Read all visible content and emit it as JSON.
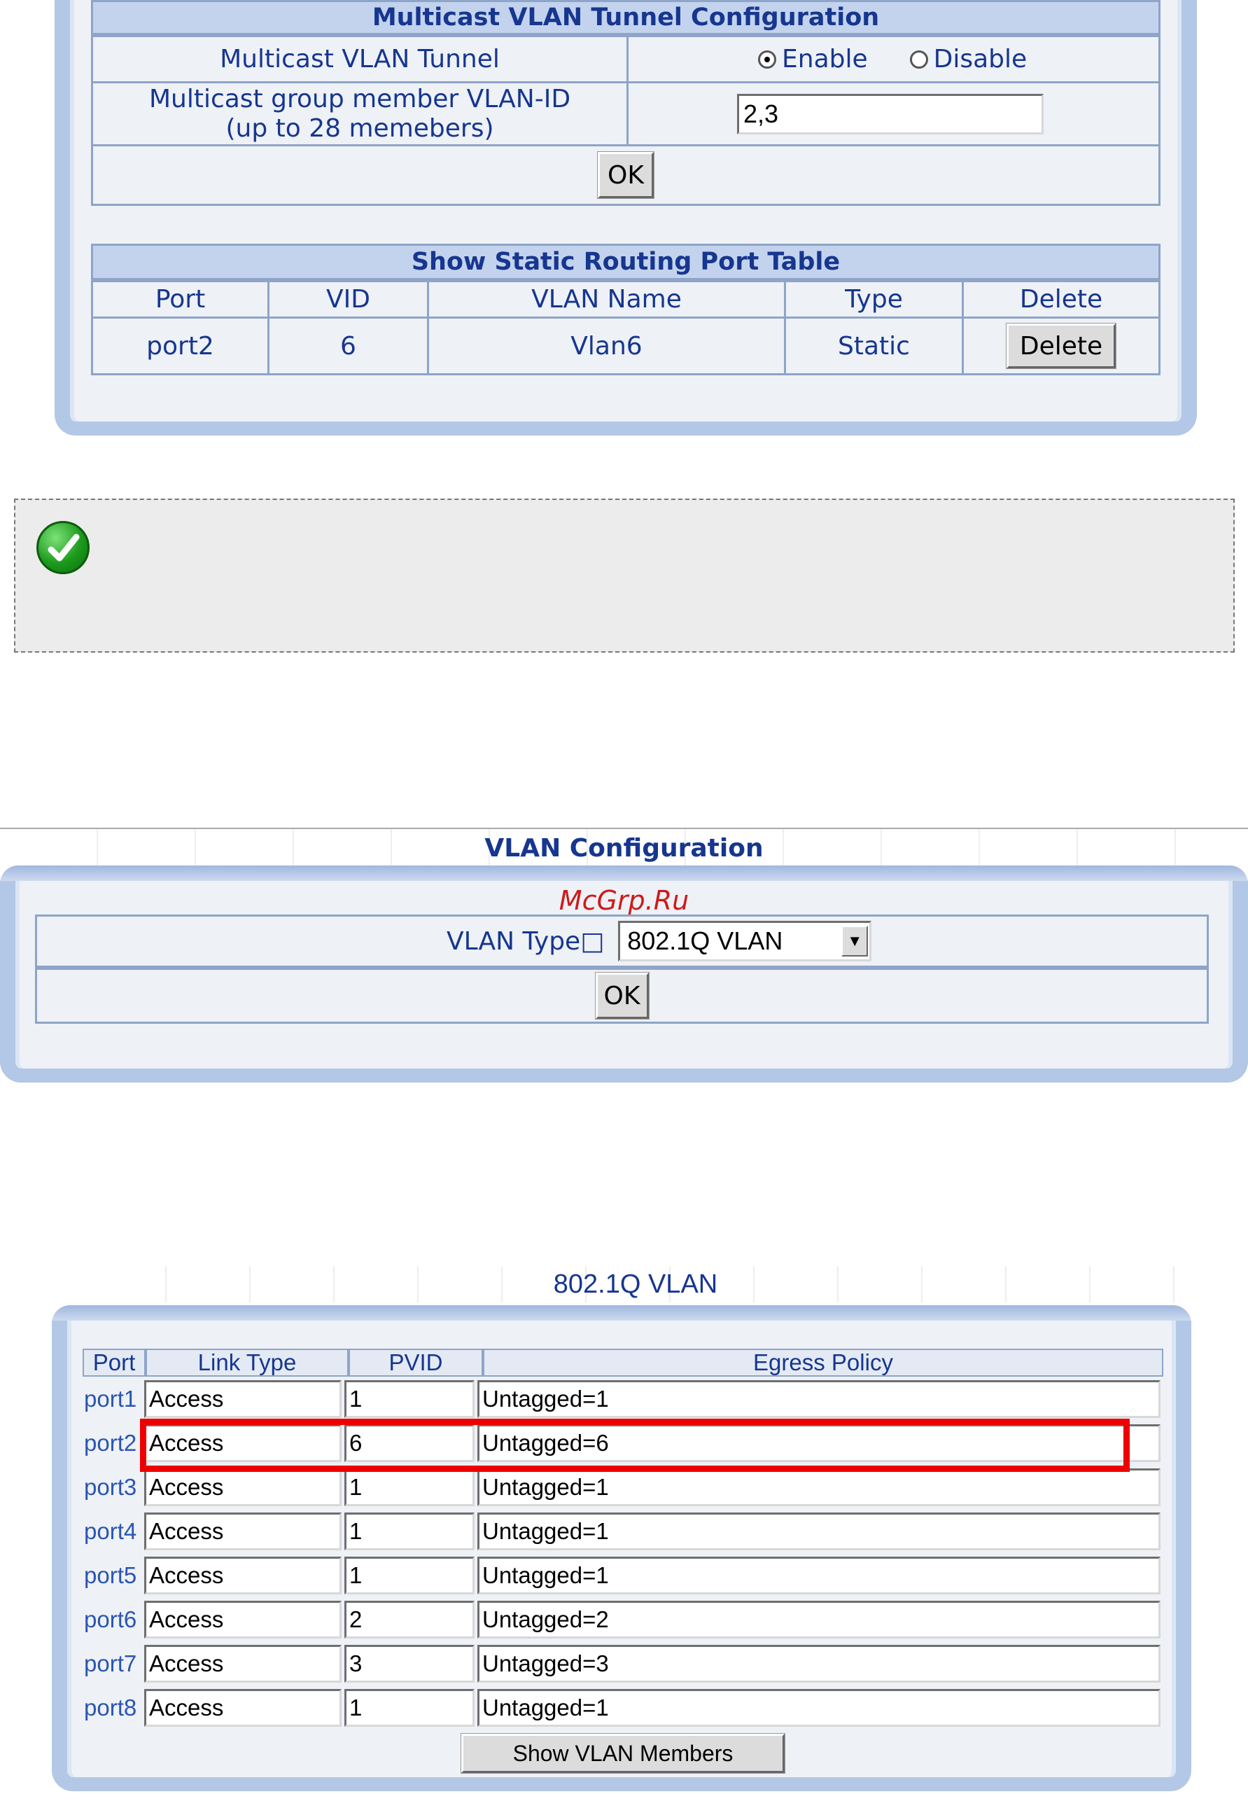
{
  "multicast": {
    "title": "Multicast VLAN Tunnel Configuration",
    "tunnel_label": "Multicast VLAN Tunnel",
    "enable_label": "Enable",
    "disable_label": "Disable",
    "selected": "Enable",
    "member_label_line1": "Multicast group member VLAN-ID",
    "member_label_line2": "(up to 28 memebers)",
    "member_value": "2,3",
    "ok_label": "OK"
  },
  "static_routing": {
    "title": "Show Static Routing Port Table",
    "headers": [
      "Port",
      "VID",
      "VLAN Name",
      "Type",
      "Delete"
    ],
    "rows": [
      {
        "port": "port2",
        "vid": "6",
        "vlan_name": "Vlan6",
        "type": "Static",
        "delete_label": "Delete"
      }
    ]
  },
  "notice": {
    "icon": "check-icon"
  },
  "vlan_config": {
    "title": "VLAN Configuration",
    "watermark": "McGrp.Ru",
    "vlan_type_label": "VLAN Type□",
    "vlan_type_value": "802.1Q VLAN",
    "ok_label": "OK"
  },
  "dot1q": {
    "title": "802.1Q  VLAN",
    "headers": [
      "Port",
      "Link Type",
      "PVID",
      "Egress Policy"
    ],
    "rows": [
      {
        "port": "port1",
        "link_type": "Access",
        "pvid": "1",
        "egress": "Untagged=1"
      },
      {
        "port": "port2",
        "link_type": "Access",
        "pvid": "6",
        "egress": "Untagged=6"
      },
      {
        "port": "port3",
        "link_type": "Access",
        "pvid": "1",
        "egress": "Untagged=1"
      },
      {
        "port": "port4",
        "link_type": "Access",
        "pvid": "1",
        "egress": "Untagged=1"
      },
      {
        "port": "port5",
        "link_type": "Access",
        "pvid": "1",
        "egress": "Untagged=1"
      },
      {
        "port": "port6",
        "link_type": "Access",
        "pvid": "2",
        "egress": "Untagged=2"
      },
      {
        "port": "port7",
        "link_type": "Access",
        "pvid": "3",
        "egress": "Untagged=3"
      },
      {
        "port": "port8",
        "link_type": "Access",
        "pvid": "1",
        "egress": "Untagged=1"
      }
    ],
    "show_members_label": "Show VLAN Members",
    "highlight_color": "#ee0000"
  }
}
